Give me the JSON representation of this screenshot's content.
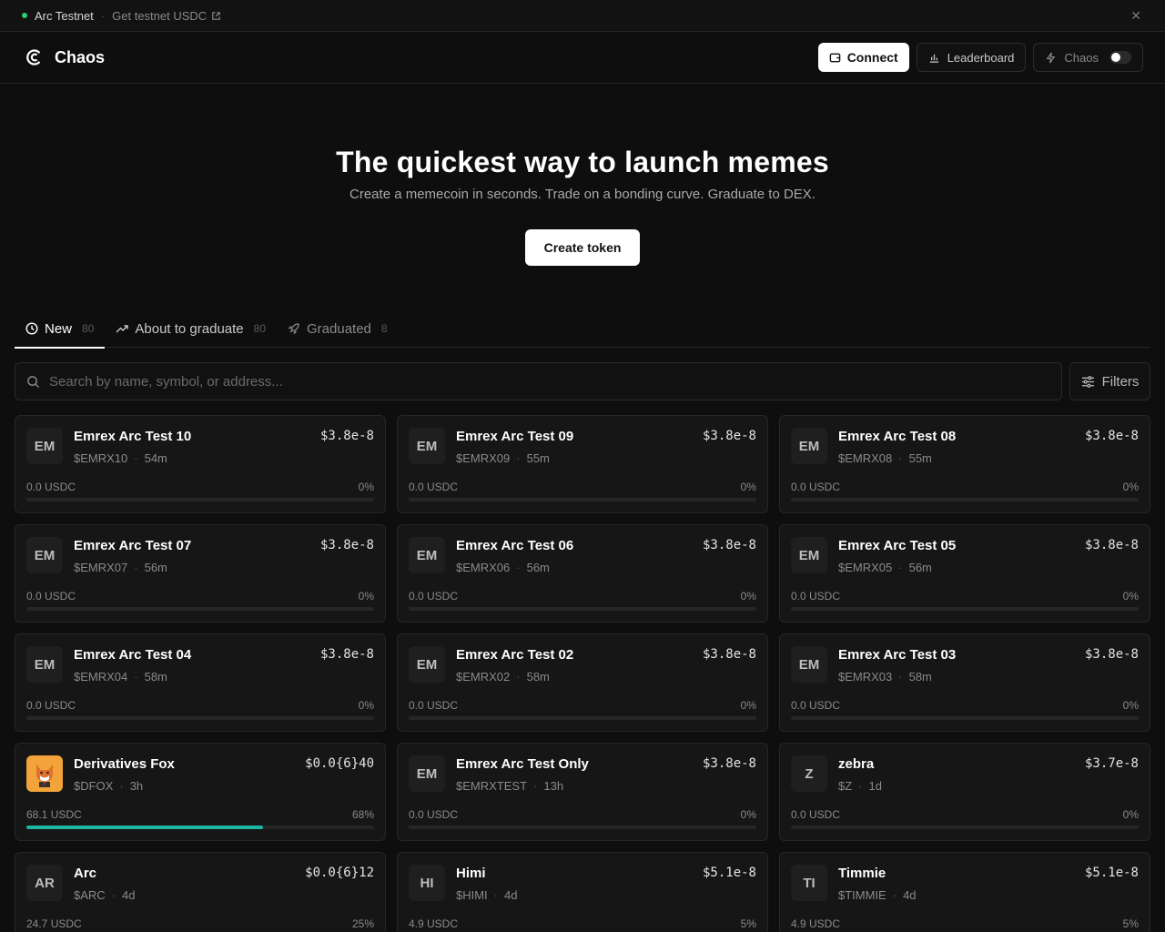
{
  "banner": {
    "network": "Arc Testnet",
    "faucet_link": "Get testnet USDC"
  },
  "header": {
    "brand": "Chaos",
    "connect": "Connect",
    "leaderboard": "Leaderboard",
    "chaos_toggle": "Chaos"
  },
  "hero": {
    "title": "The quickest way to launch memes",
    "subtitle": "Create a memecoin in seconds. Trade on a bonding curve. Graduate to DEX.",
    "cta": "Create token"
  },
  "tabs": [
    {
      "label": "New",
      "count": "80",
      "active": true,
      "icon": "clock-icon"
    },
    {
      "label": "About to graduate",
      "count": "80",
      "active": false,
      "icon": "trending-up-icon"
    },
    {
      "label": "Graduated",
      "count": "8",
      "active": false,
      "icon": "rocket-icon"
    }
  ],
  "search": {
    "placeholder": "Search by name, symbol, or address..."
  },
  "filters": {
    "label": "Filters"
  },
  "tokens": [
    {
      "avatar": "EM",
      "name": "Emrex Arc Test 10",
      "symbol": "$EMRX10",
      "age": "54m",
      "price": "$3.8e-8",
      "liquidity": "0.0 USDC",
      "progress": "0%",
      "progress_value": 0
    },
    {
      "avatar": "EM",
      "name": "Emrex Arc Test 09",
      "symbol": "$EMRX09",
      "age": "55m",
      "price": "$3.8e-8",
      "liquidity": "0.0 USDC",
      "progress": "0%",
      "progress_value": 0
    },
    {
      "avatar": "EM",
      "name": "Emrex Arc Test 08",
      "symbol": "$EMRX08",
      "age": "55m",
      "price": "$3.8e-8",
      "liquidity": "0.0 USDC",
      "progress": "0%",
      "progress_value": 0
    },
    {
      "avatar": "EM",
      "name": "Emrex Arc Test 07",
      "symbol": "$EMRX07",
      "age": "56m",
      "price": "$3.8e-8",
      "liquidity": "0.0 USDC",
      "progress": "0%",
      "progress_value": 0
    },
    {
      "avatar": "EM",
      "name": "Emrex Arc Test 06",
      "symbol": "$EMRX06",
      "age": "56m",
      "price": "$3.8e-8",
      "liquidity": "0.0 USDC",
      "progress": "0%",
      "progress_value": 0
    },
    {
      "avatar": "EM",
      "name": "Emrex Arc Test 05",
      "symbol": "$EMRX05",
      "age": "56m",
      "price": "$3.8e-8",
      "liquidity": "0.0 USDC",
      "progress": "0%",
      "progress_value": 0
    },
    {
      "avatar": "EM",
      "name": "Emrex Arc Test 04",
      "symbol": "$EMRX04",
      "age": "58m",
      "price": "$3.8e-8",
      "liquidity": "0.0 USDC",
      "progress": "0%",
      "progress_value": 0
    },
    {
      "avatar": "EM",
      "name": "Emrex Arc Test 02",
      "symbol": "$EMRX02",
      "age": "58m",
      "price": "$3.8e-8",
      "liquidity": "0.0 USDC",
      "progress": "0%",
      "progress_value": 0
    },
    {
      "avatar": "EM",
      "name": "Emrex Arc Test 03",
      "symbol": "$EMRX03",
      "age": "58m",
      "price": "$3.8e-8",
      "liquidity": "0.0 USDC",
      "progress": "0%",
      "progress_value": 0
    },
    {
      "avatar": "fox-image",
      "name": "Derivatives Fox",
      "symbol": "$DFOX",
      "age": "3h",
      "price": "$0.0{6}40",
      "liquidity": "68.1 USDC",
      "progress": "68%",
      "progress_value": 68
    },
    {
      "avatar": "EM",
      "name": "Emrex Arc Test Only",
      "symbol": "$EMRXTEST",
      "age": "13h",
      "price": "$3.8e-8",
      "liquidity": "0.0 USDC",
      "progress": "0%",
      "progress_value": 0
    },
    {
      "avatar": "Z",
      "name": "zebra",
      "symbol": "$Z",
      "age": "1d",
      "price": "$3.7e-8",
      "liquidity": "0.0 USDC",
      "progress": "0%",
      "progress_value": 0
    },
    {
      "avatar": "AR",
      "name": "Arc",
      "symbol": "$ARC",
      "age": "4d",
      "price": "$0.0{6}12",
      "liquidity": "24.7 USDC",
      "progress": "25%",
      "progress_value": 25
    },
    {
      "avatar": "HI",
      "name": "Himi",
      "symbol": "$HIMI",
      "age": "4d",
      "price": "$5.1e-8",
      "liquidity": "4.9 USDC",
      "progress": "5%",
      "progress_value": 5
    },
    {
      "avatar": "TI",
      "name": "Timmie",
      "symbol": "$TIMMIE",
      "age": "4d",
      "price": "$5.1e-8",
      "liquidity": "4.9 USDC",
      "progress": "5%",
      "progress_value": 5
    }
  ],
  "colors": {
    "background": "#0e0e0e",
    "card": "#161616",
    "accent_progress": "#1fb5a5",
    "status_online": "#2ecc71"
  }
}
